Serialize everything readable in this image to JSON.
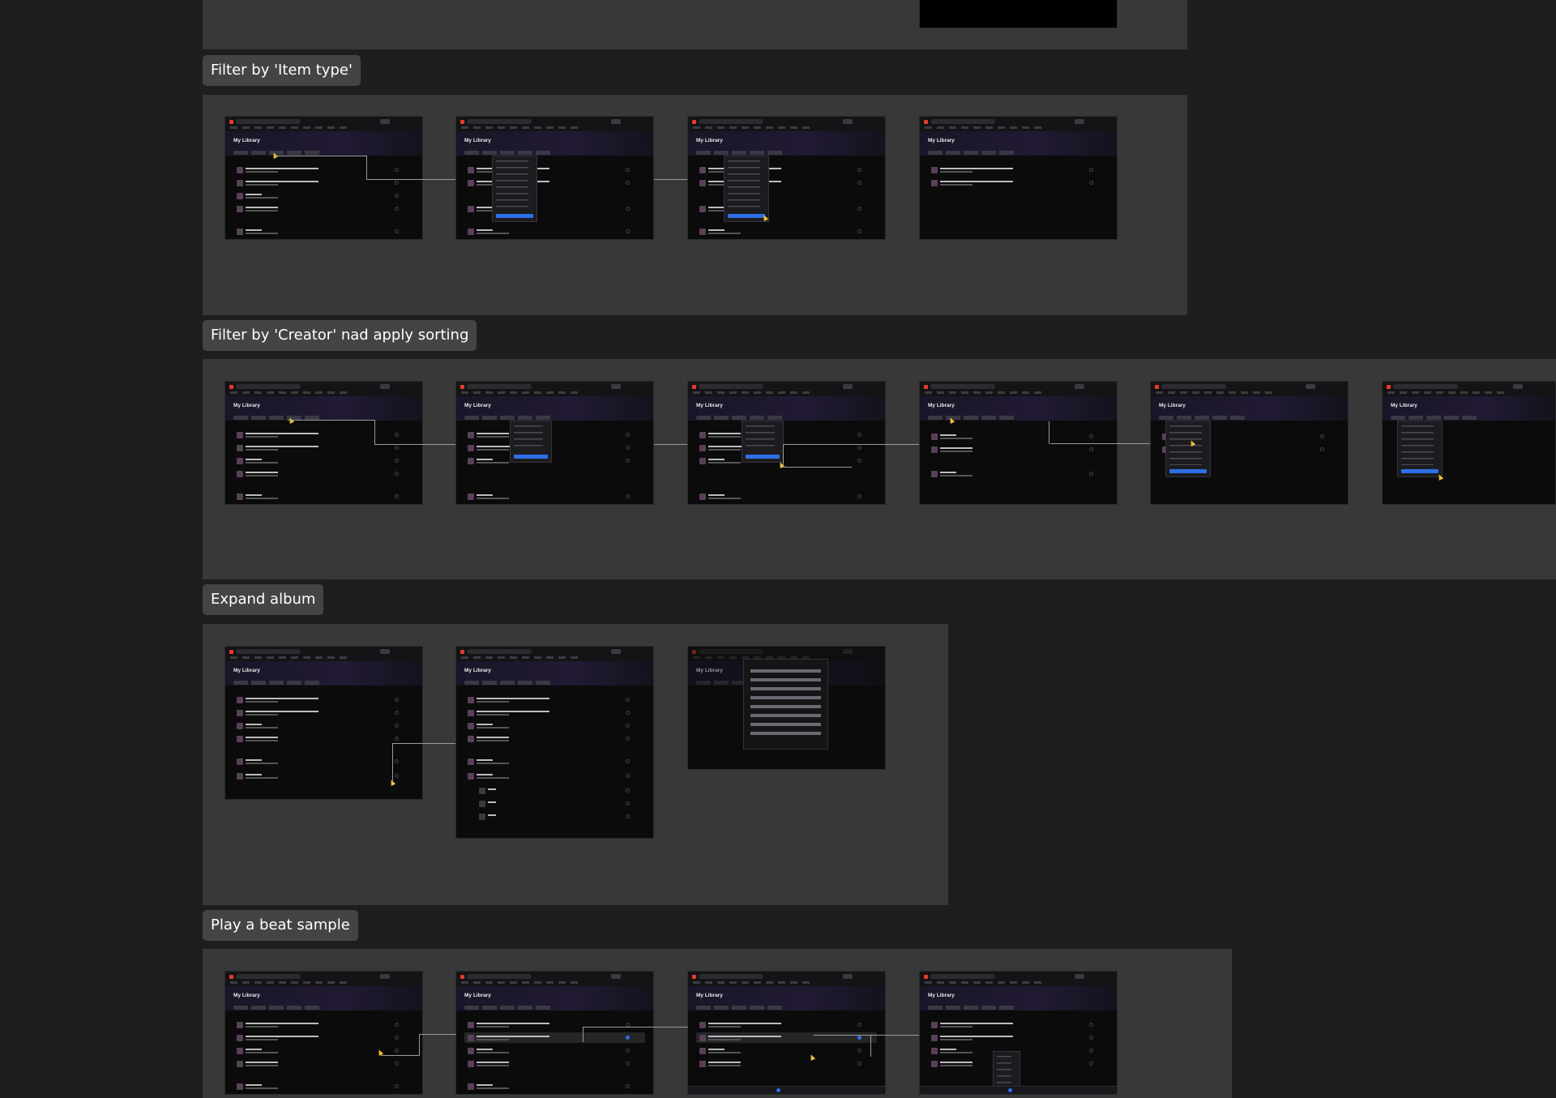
{
  "sections": {
    "item_type": {
      "label": "Filter by 'Item type'"
    },
    "creator": {
      "label": "Filter by 'Creator' nad apply sorting"
    },
    "expand": {
      "label": "Expand album"
    },
    "play": {
      "label": "Play a beat sample"
    }
  },
  "screen": {
    "title": "My Library"
  },
  "colors": {
    "canvas": "#1e1e1e",
    "section": "#383838",
    "label_bg": "#444444",
    "accent": "#2f6fe8",
    "cursor": "#f2c230",
    "logo": "#e63a2e"
  },
  "icons": [
    "cursor-icon",
    "logo-icon",
    "play-icon"
  ]
}
